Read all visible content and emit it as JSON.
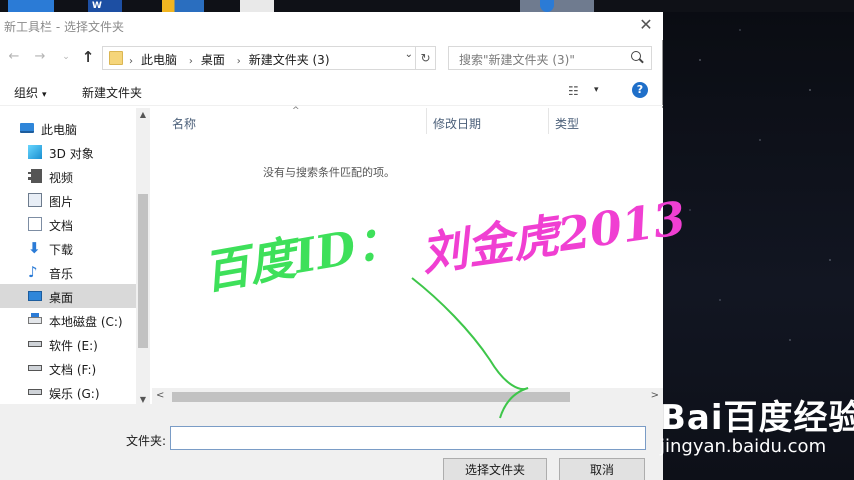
{
  "window": {
    "title": "新工具栏 - 选择文件夹",
    "close_glyph": "✕"
  },
  "taskbar": {
    "app2_label": "W"
  },
  "navigation": {
    "back_glyph": "←",
    "forward_glyph": "→",
    "recent_glyph": "⌄",
    "up_glyph": "↑",
    "breadcrumbs": [
      "此电脑",
      "桌面",
      "新建文件夹 (3)"
    ],
    "refresh_glyph": "↻",
    "dropdown_glyph": "⌄"
  },
  "search": {
    "placeholder": "搜索\"新建文件夹 (3)\""
  },
  "toolbar": {
    "organize_label": "组织",
    "organize_caret": "▾",
    "new_folder_label": "新建文件夹",
    "view_glyph": "☷",
    "view_caret": "▾",
    "help_glyph": "?"
  },
  "sidebar": {
    "items": [
      {
        "label": "此电脑",
        "icon": "pc-icon"
      },
      {
        "label": "3D 对象",
        "icon": "3d-objects-icon"
      },
      {
        "label": "视频",
        "icon": "video-icon"
      },
      {
        "label": "图片",
        "icon": "pictures-icon"
      },
      {
        "label": "文档",
        "icon": "documents-icon"
      },
      {
        "label": "下载",
        "icon": "download-icon",
        "glyph": "⬇"
      },
      {
        "label": "音乐",
        "icon": "music-icon",
        "glyph": "♪"
      },
      {
        "label": "桌面",
        "icon": "desktop-icon",
        "selected": true
      },
      {
        "label": "本地磁盘 (C:)",
        "icon": "drive-c-icon"
      },
      {
        "label": "软件 (E:)",
        "icon": "drive-icon"
      },
      {
        "label": "文档 (F:)",
        "icon": "drive-icon"
      },
      {
        "label": "娱乐 (G:)",
        "icon": "drive-icon"
      }
    ],
    "scroll_up_glyph": "▲",
    "scroll_down_glyph": "▼"
  },
  "file_list": {
    "columns": [
      "名称",
      "修改日期",
      "类型"
    ],
    "sort_glyph": "^",
    "empty_message": "没有与搜索条件匹配的项。",
    "scroll_left_glyph": "<",
    "scroll_right_glyph": ">"
  },
  "footer": {
    "folder_label": "文件夹:",
    "folder_value": "",
    "select_button": "选择文件夹",
    "cancel_button": "取消"
  },
  "watermark": {
    "part1": "百度ID：",
    "part2": "刘金虎2013"
  },
  "baidu_logo": {
    "main": "Bai百度经验",
    "sub": "jingyan.baidu.com"
  },
  "colors": {
    "accent": "#2b7bd6",
    "selected_bg": "#d9d9d9",
    "watermark_green": "#3ee05a",
    "watermark_magenta": "#f03fd2"
  }
}
